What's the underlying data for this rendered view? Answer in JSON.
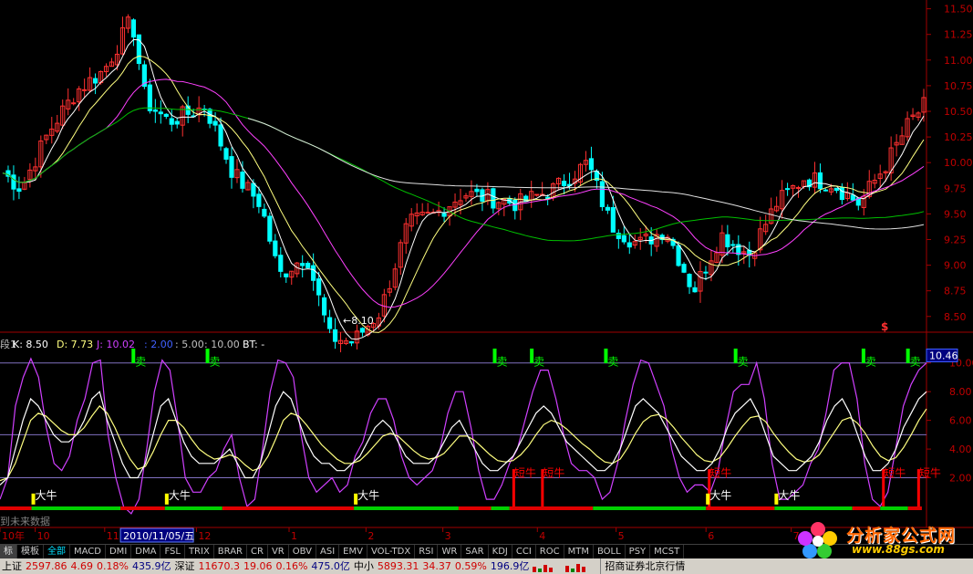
{
  "chart_data": {
    "type": "candlestick_with_indicator",
    "price_axis": {
      "ticks": [
        "11.50",
        "11.25",
        "11.00",
        "10.75",
        "10.50",
        "10.25",
        "10.00",
        "9.75",
        "9.50",
        "9.25",
        "9.00",
        "8.75",
        "8.50"
      ],
      "min": 8.4,
      "max": 11.55
    },
    "low_annotation": "←8.10",
    "indicator": {
      "header": {
        "prefix": "段1",
        "k": "K: 8.50",
        "d": "D: 7.73",
        "j": "J: 10.02",
        "p1": ": 2.00",
        "p2": ": 5.00",
        "p3": ": 10.00",
        "bt": "BT: -"
      },
      "axis_ticks": [
        "10.00",
        "8.00",
        "6.00",
        "4.00",
        "2.00"
      ],
      "current_value": "10.46",
      "ref_levels": [
        10,
        5,
        2
      ],
      "k_series": [
        1.5,
        2,
        4,
        6,
        7.5,
        7,
        6,
        5,
        4.5,
        4.5,
        5,
        6,
        7.5,
        8,
        6,
        4.5,
        3,
        2,
        2,
        3,
        5,
        7,
        7.5,
        6,
        4.5,
        3.5,
        3,
        3,
        3,
        3.5,
        4,
        3,
        2,
        2,
        3,
        5,
        7,
        8,
        7.5,
        6,
        4.5,
        3.5,
        3,
        3,
        2.5,
        2.5,
        3,
        3.5,
        4.5,
        5.5,
        6,
        5.5,
        4.5,
        3.5,
        3,
        3,
        3,
        3.5,
        4.5,
        5.5,
        6,
        5,
        4,
        3,
        2.5,
        2.5,
        3,
        3.5,
        4.5,
        5.5,
        6.5,
        7,
        6.5,
        5.5,
        4.5,
        4,
        3.5,
        3,
        2.5,
        2.5,
        3,
        4,
        5.5,
        7,
        7.5,
        7,
        6.5,
        5.5,
        4.5,
        3.5,
        3,
        2.5,
        2.5,
        3,
        4,
        5.5,
        6.5,
        7,
        7.5,
        6.5,
        5,
        3.5,
        3,
        2.5,
        2.5,
        3,
        3.5,
        4.5,
        6,
        7,
        7.5,
        6.5,
        5,
        3.5,
        2.5,
        2.5,
        3,
        4,
        5.5,
        6.5,
        7.5,
        8
      ],
      "d_series": [
        1.8,
        2,
        3,
        4.5,
        6,
        6.5,
        6.3,
        5.8,
        5.3,
        5,
        5,
        5.5,
        6.3,
        7,
        6.5,
        5.5,
        4.3,
        3.3,
        2.6,
        2.8,
        3.8,
        5,
        6,
        6,
        5.5,
        4.7,
        4,
        3.6,
        3.3,
        3.4,
        3.6,
        3.4,
        2.9,
        2.5,
        2.7,
        3.5,
        4.7,
        6,
        6.5,
        6.3,
        5.7,
        5,
        4.3,
        3.8,
        3.3,
        3,
        3,
        3.2,
        3.7,
        4.3,
        4.9,
        5.1,
        4.9,
        4.4,
        3.9,
        3.5,
        3.3,
        3.4,
        3.7,
        4.3,
        4.9,
        4.9,
        4.6,
        4.1,
        3.6,
        3.2,
        3.1,
        3.2,
        3.6,
        4.2,
        5,
        5.7,
        6,
        5.8,
        5.4,
        4.9,
        4.4,
        4,
        3.5,
        3.1,
        3,
        3.3,
        4.1,
        5.1,
        5.9,
        6.3,
        6.4,
        6.1,
        5.5,
        4.8,
        4.2,
        3.6,
        3.2,
        3.1,
        3.4,
        4.1,
        4.9,
        5.6,
        6.2,
        6.3,
        5.9,
        5.1,
        4.4,
        3.8,
        3.3,
        3.1,
        3.2,
        3.6,
        4.4,
        5.2,
        6,
        6.2,
        5.8,
        5.1,
        4.2,
        3.5,
        3.2,
        3.4,
        4.1,
        5,
        6,
        6.8
      ],
      "j_series": [
        0.5,
        2,
        7,
        9,
        10.3,
        9,
        5.5,
        3,
        2.5,
        3.5,
        6,
        7.5,
        10,
        10.2,
        5,
        2,
        0,
        -0.5,
        0.5,
        4,
        8,
        10.2,
        9.5,
        6,
        2,
        1,
        1,
        2,
        2.5,
        4,
        5,
        2,
        0,
        0.5,
        4,
        8,
        10.2,
        10,
        9,
        5,
        2,
        1,
        1.5,
        2,
        1,
        1.5,
        3.5,
        4.5,
        6.5,
        7.5,
        7.5,
        6,
        3.5,
        2,
        1.5,
        2,
        2.5,
        4,
        6.5,
        8,
        8,
        5.5,
        2.5,
        0.5,
        0.5,
        1.5,
        3,
        4,
        6,
        8,
        9.5,
        9.5,
        7.5,
        5,
        3,
        2.5,
        2.5,
        2,
        0.5,
        1,
        3,
        6,
        8.5,
        10.2,
        10,
        8.5,
        7,
        4,
        2,
        1,
        1.5,
        1.5,
        1,
        2.5,
        5.5,
        8,
        8.5,
        8.5,
        10,
        7.5,
        3,
        0.5,
        0.5,
        1,
        1.5,
        3,
        4,
        6.5,
        9.5,
        10,
        10,
        7.5,
        3,
        0.5,
        0,
        1,
        4,
        7,
        8.5,
        9.5,
        10
      ]
    },
    "signals": {
      "sell_label": "卖",
      "sell_x": [
        0.142,
        0.222,
        0.532,
        0.572,
        0.652,
        0.792,
        0.93,
        0.978
      ],
      "short_bull_label": "短牛",
      "short_bull_x": [
        0.553,
        0.584,
        0.764,
        0.952,
        0.99
      ],
      "big_bull_label": "大牛",
      "big_bull_x": [
        0.034,
        0.178,
        0.382,
        0.762,
        0.836
      ]
    },
    "x_axis": {
      "ticks": [
        "10年",
        "10",
        "11",
        "2010/11/05/五",
        "12",
        "1",
        "2",
        "3",
        "4",
        "5",
        "6",
        "7"
      ],
      "ticks_x": [
        0.0,
        0.038,
        0.113,
        0.13,
        0.212,
        0.312,
        0.395,
        0.478,
        0.58,
        0.665,
        0.762,
        0.854
      ]
    },
    "future_data_label": "到未来数据",
    "top_marker": "$"
  },
  "tabs": [
    "标",
    "模板",
    "全部",
    "MACD",
    "DMI",
    "DMA",
    "FSL",
    "TRIX",
    "BRAR",
    "CR",
    "VR",
    "OBV",
    "ASI",
    "EMV",
    "VOL-TDX",
    "RSI",
    "WR",
    "SAR",
    "KDJ",
    "CCI",
    "ROC",
    "MTM",
    "BOLL",
    "PSY",
    "MCST"
  ],
  "status": {
    "sh_label": "上证",
    "sh_value": "2597.86",
    "sh_change": "4.69",
    "sh_pct": "0.18%",
    "sh_vol": "435.9亿",
    "sz_label": "深证",
    "sz_value": "11670.3",
    "sz_change": "19.06",
    "sz_pct": "0.16%",
    "sz_vol": "475.0亿",
    "zx_label": "中小",
    "zx_value": "5893.31",
    "zx_change": "34.37",
    "zx_pct": "0.59%",
    "zx_vol": "196.9亿",
    "broker": "招商证券北京行情"
  },
  "logo": {
    "name": "分析家公式网",
    "url": "www.88gs.com"
  },
  "colors": {
    "up": "#ff3030",
    "down": "#00ffff",
    "ma5": "#ffffff",
    "ma10": "#ffff80",
    "ma20": "#ff40ff",
    "ma60": "#00c000",
    "ma120": "#e0e0e0",
    "k": "#ffffff",
    "d": "#ffff80",
    "j": "#d040ff",
    "sell": "#00ff00",
    "bull": "#ff0000",
    "bigbull": "#ffff00"
  }
}
